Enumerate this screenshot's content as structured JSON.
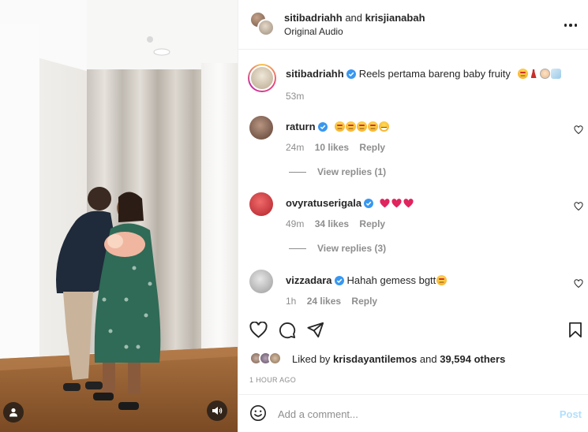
{
  "header": {
    "user1": "sitibadriahh",
    "joiner": "and",
    "user2": "krisjianabah",
    "audio": "Original Audio"
  },
  "caption": {
    "username": "sitibadriahh",
    "text": "Reels pertama bareng baby fruity",
    "emojis": [
      "star-struck",
      "dancer",
      "baby",
      "unicorn"
    ],
    "time": "53m"
  },
  "comments": [
    {
      "username": "raturn",
      "emojis": [
        "star-struck",
        "star-struck",
        "star-struck",
        "star-struck",
        "grinning"
      ],
      "text": "",
      "time": "24m",
      "likes": "10 likes",
      "reply": "Reply",
      "view_replies": "View replies (1)"
    },
    {
      "username": "ovyratuserigala",
      "emojis": [
        "red-heart",
        "red-heart",
        "red-heart"
      ],
      "text": "",
      "time": "49m",
      "likes": "34 likes",
      "reply": "Reply",
      "view_replies": "View replies (3)"
    },
    {
      "username": "vizzadara",
      "emojis": [
        "star-struck"
      ],
      "text": "Hahah gemess bgtt",
      "time": "1h",
      "likes": "24 likes",
      "reply": "Reply",
      "view_replies": ""
    }
  ],
  "likes": {
    "prefix": "Liked by",
    "user": "krisdayantilemos",
    "middle": "and",
    "others": "39,594 others"
  },
  "post_age": "1 HOUR AGO",
  "add_comment": {
    "placeholder": "Add a comment...",
    "post_label": "Post"
  },
  "colors": {
    "verified": "#3897f0",
    "muted_text": "#8e8e8e",
    "post_disabled": "#b2dffc",
    "heart_red": "#e0245e"
  },
  "icons": [
    "more-icon",
    "verified-icon",
    "heart-icon",
    "comment-icon",
    "share-icon",
    "bookmark-icon",
    "emoji-icon",
    "user-icon",
    "sound-icon"
  ]
}
